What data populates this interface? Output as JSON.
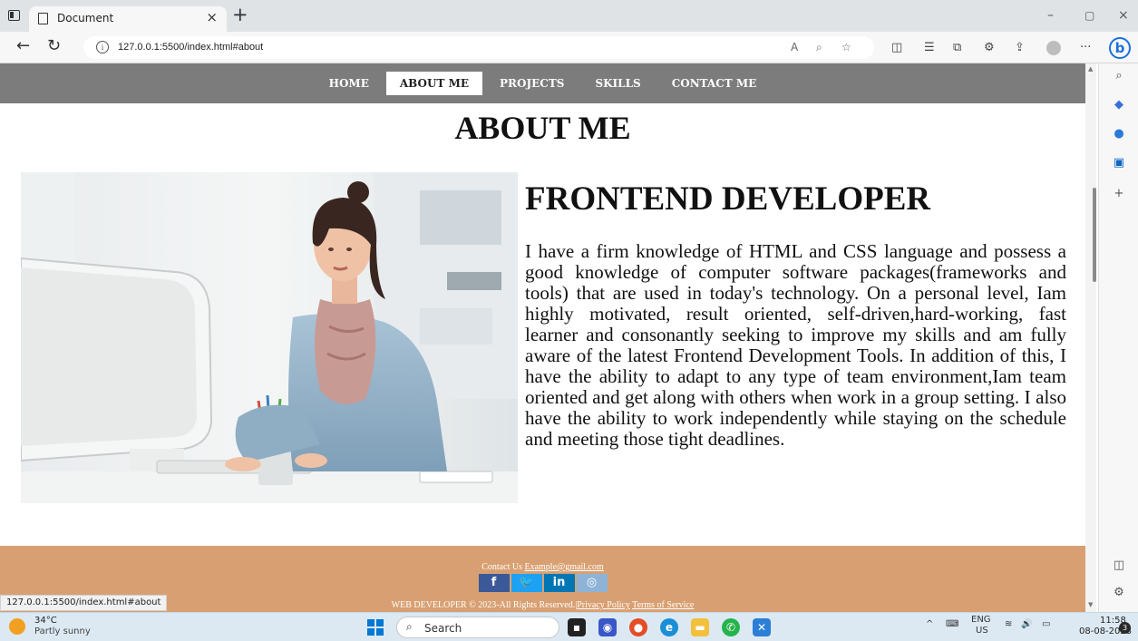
{
  "browser": {
    "tab_title": "Document",
    "tab_close": "×",
    "new_tab": "+",
    "url": "127.0.0.1:5500/index.html#about",
    "window_controls": [
      "–",
      "▢",
      "×"
    ],
    "status_url": "127.0.0.1:5500/index.html#about",
    "more_label": "···"
  },
  "site": {
    "nav": [
      "HOME",
      "ABOUT ME",
      "PROJECTS",
      "SKILLS",
      "CONTACT ME"
    ],
    "active_nav": "ABOUT ME",
    "page_title": "ABOUT ME",
    "heading": "FRONTEND DEVELOPER",
    "paragraph": "I have a firm knowledge of HTML and CSS language and possess a good knowledge of computer software packages(frameworks and tools) that are used in today's technology. On a personal level, Iam highly motivated, result oriented, self-driven,hard-working, fast learner and consonantly seeking to improve my skills and am fully aware of the latest Frontend Development Tools. In addition of this, I have the ability to adapt to any type of team environment,Iam team oriented and get along with others when work in a group setting. I also have the ability to work independently while staying on the schedule and meeting those tight deadlines.",
    "footer": {
      "contact_prefix": "Contact Us",
      "contact_email": "Example@gmail.com",
      "socials": [
        {
          "label": "f",
          "color": "#3b5998"
        },
        {
          "label": "🐦",
          "color": "#1da1f2"
        },
        {
          "label": "in",
          "color": "#0077b5"
        },
        {
          "label": "◎",
          "color": "#8fb3d6"
        }
      ],
      "copyright": "WEB DEVELOPER © 2023-All Rights Reserved.",
      "separator": "|",
      "privacy": "Privacy Policy",
      "terms": "Terms of Service",
      "background": "#d8a072"
    }
  },
  "taskbar": {
    "temperature": "34°C",
    "weather": "Partly sunny",
    "search_placeholder": "Search",
    "language_top": "ENG",
    "language_bottom": "US",
    "time": "11:58",
    "date": "08-08-2023",
    "notifications": "3"
  },
  "colors": {
    "nav_bg": "#7c7c7c",
    "footer_bg": "#d8a072",
    "taskbar_bg": "#dce9f3"
  }
}
